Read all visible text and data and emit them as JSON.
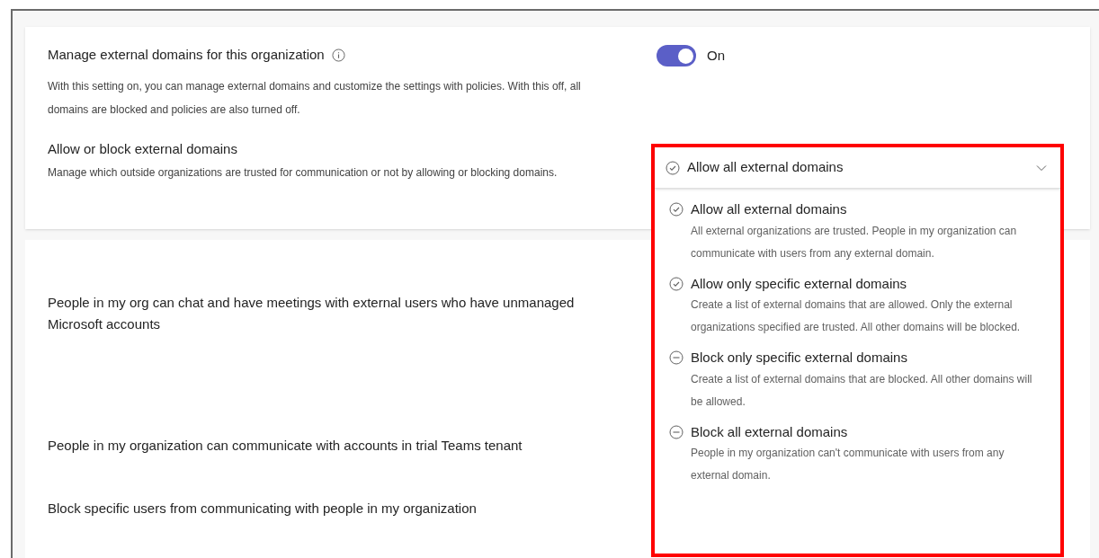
{
  "manage": {
    "title": "Manage external domains for this organization",
    "description": "With this setting on, you can manage external domains and customize the settings with policies. With this off, all domains are blocked and policies are also turned off.",
    "toggle": {
      "on": true,
      "label": "On"
    }
  },
  "allow_block": {
    "title": "Allow or block external domains",
    "description": "Manage which outside organizations are trusted for communication or not by allowing or blocking domains.",
    "dropdown": {
      "value": "Allow all external domains",
      "expanded": true,
      "options": [
        {
          "kind": "allow",
          "title": "Allow all external domains",
          "description": "All external organizations are trusted. People in my organization can communicate with users from any external domain."
        },
        {
          "kind": "allow",
          "title": "Allow only specific external domains",
          "description": "Create a list of external domains that are allowed. Only the external organizations specified are trusted. All other domains will be blocked."
        },
        {
          "kind": "block",
          "title": "Block only specific external domains",
          "description": "Create a list of external domains that are blocked. All other domains will be allowed."
        },
        {
          "kind": "block",
          "title": "Block all external domains",
          "description": "People in my organization can't communicate with users from any external domain."
        }
      ]
    }
  },
  "settings": [
    {
      "title": "People in my org can chat and have meetings with external users who have unmanaged Microsoft accounts"
    },
    {
      "title": "People in my organization can communicate with accounts in trial Teams tenant"
    },
    {
      "title": "Block specific users from communicating with people in my organization"
    }
  ]
}
